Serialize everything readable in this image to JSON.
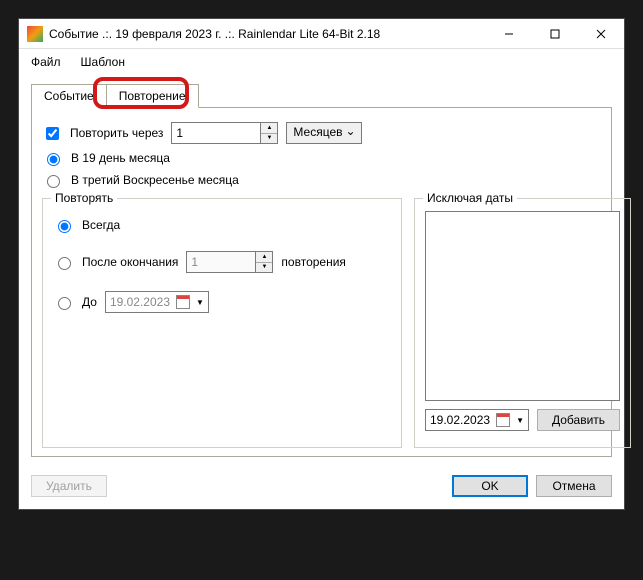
{
  "title": "Событие .:. 19 февраля 2023 г. .:. Rainlendar Lite 64-Bit 2.18",
  "menu": {
    "file": "Файл",
    "template": "Шаблон"
  },
  "tabs": {
    "event": "Событие",
    "repetition": "Повторение"
  },
  "repeat_every": {
    "label": "Повторить через",
    "value": "1",
    "unit": "Месяцев"
  },
  "day_option_a": "В 19 день месяца",
  "day_option_b": "В третий Воскресенье месяца",
  "repeat_group": {
    "legend": "Повторять",
    "always": "Всегда",
    "after_end": {
      "label": "После окончания",
      "value": "1",
      "suffix": "повторения"
    },
    "until": {
      "label": "До",
      "date": "19.02.2023"
    }
  },
  "exclude_group": {
    "legend": "Исключая даты",
    "date": "19.02.2023",
    "add": "Добавить"
  },
  "footer": {
    "delete": "Удалить",
    "ok": "OK",
    "cancel": "Отмена"
  }
}
